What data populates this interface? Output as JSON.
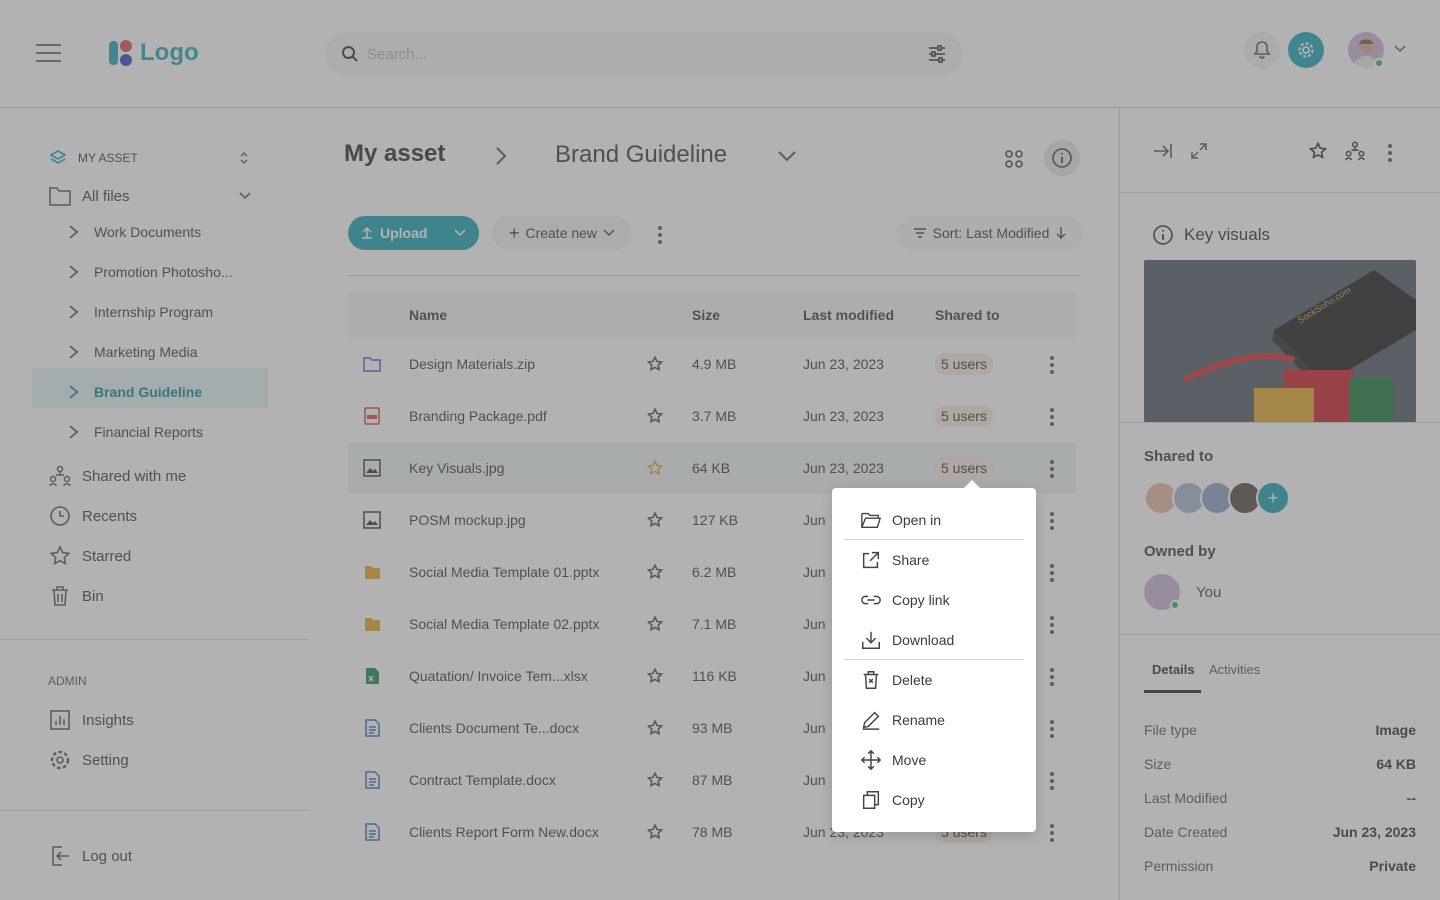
{
  "header": {
    "logo_text": "Logo",
    "search_placeholder": "Search...",
    "accent": "#15a1b8"
  },
  "sidebar": {
    "section_title": "MY ASSET",
    "all_files": "All files",
    "folders": [
      {
        "label": "Work Documents"
      },
      {
        "label": "Promotion Photosho..."
      },
      {
        "label": "Internship Program"
      },
      {
        "label": "Marketing Media"
      },
      {
        "label": "Brand Guideline",
        "active": true
      },
      {
        "label": "Financial Reports"
      }
    ],
    "nav": [
      {
        "label": "Shared with me",
        "icon": "shared-icon"
      },
      {
        "label": "Recents",
        "icon": "clock-icon"
      },
      {
        "label": "Starred",
        "icon": "star-icon"
      },
      {
        "label": "Bin",
        "icon": "trash-icon"
      }
    ],
    "admin_title": "ADMIN",
    "admin": [
      {
        "label": "Insights",
        "icon": "chart-icon"
      },
      {
        "label": "Setting",
        "icon": "gear-icon"
      }
    ],
    "logout": "Log out"
  },
  "main": {
    "breadcrumb_root": "My asset",
    "breadcrumb_current": "Brand Guideline",
    "upload_label": "Upload",
    "create_label": "Create new",
    "sort_label": "Sort: Last Modified",
    "columns": {
      "name": "Name",
      "size": "Size",
      "modified": "Last modified",
      "shared": "Shared to"
    },
    "files": [
      {
        "name": "Design Materials.zip",
        "type": "folder",
        "size": "4.9 MB",
        "modified": "Jun 23, 2023",
        "shared": "5 users"
      },
      {
        "name": "Branding Package.pdf",
        "type": "pdf",
        "size": "3.7 MB",
        "modified": "Jun 23, 2023",
        "shared": "5 users"
      },
      {
        "name": "Key Visuals.jpg",
        "type": "image",
        "size": "64 KB",
        "modified": "Jun 23, 2023",
        "shared": "5 users",
        "starred": true,
        "selected": true
      },
      {
        "name": "POSM mockup.jpg",
        "type": "image",
        "size": "127 KB",
        "modified": "Jun",
        "shared": ""
      },
      {
        "name": "Social Media Template 01.pptx",
        "type": "pptx",
        "size": "6.2 MB",
        "modified": "Jun",
        "shared": ""
      },
      {
        "name": "Social Media Template 02.pptx",
        "type": "pptx",
        "size": "7.1 MB",
        "modified": "Jun",
        "shared": ""
      },
      {
        "name": "Quatation/ Invoice Tem...xlsx",
        "type": "xlsx",
        "size": "116 KB",
        "modified": "Jun",
        "shared": ""
      },
      {
        "name": "Clients Document Te...docx",
        "type": "docx",
        "size": "93 MB",
        "modified": "Jun",
        "shared": ""
      },
      {
        "name": "Contract Template.docx",
        "type": "docx",
        "size": "87 MB",
        "modified": "Jun",
        "shared": ""
      },
      {
        "name": "Clients Report Form New.docx",
        "type": "docx",
        "size": "78 MB",
        "modified": "Jun 23, 2023",
        "shared": "5 users"
      }
    ]
  },
  "context_menu": {
    "items": [
      {
        "label": "Open in",
        "icon": "folder-open-icon"
      },
      {
        "label": "Share",
        "icon": "share-icon"
      },
      {
        "label": "Copy link",
        "icon": "link-icon"
      },
      {
        "label": "Download",
        "icon": "download-icon"
      },
      {
        "label": "Delete",
        "icon": "delete-icon"
      },
      {
        "label": "Rename",
        "icon": "pen-icon"
      },
      {
        "label": "Move",
        "icon": "move-icon"
      },
      {
        "label": "Copy",
        "icon": "copy-icon"
      }
    ]
  },
  "panel": {
    "title": "Key visuals",
    "shared_title": "Shared to",
    "owned_title": "Owned by",
    "owner": "You",
    "tabs": [
      "Details",
      "Activities"
    ],
    "details": [
      {
        "key": "File type",
        "value": "Image"
      },
      {
        "key": "Size",
        "value": "64 KB"
      },
      {
        "key": "Last Modified",
        "value": "--"
      },
      {
        "key": "Date Created",
        "value": "Jun 23, 2023"
      },
      {
        "key": "Permission",
        "value": "Private"
      }
    ],
    "preview_text": "SockSoho.com"
  }
}
